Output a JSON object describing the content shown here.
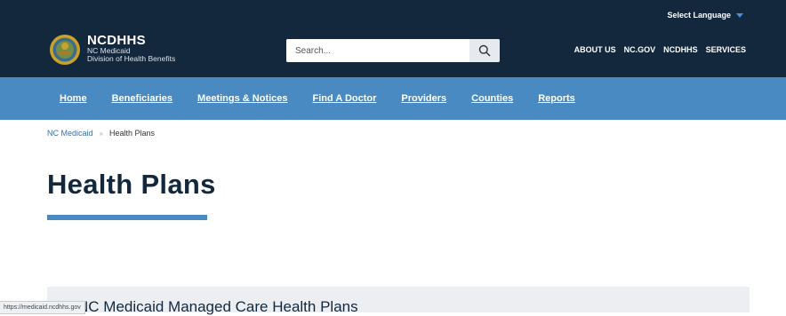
{
  "header": {
    "select_language": "Select Language",
    "brand_name": "NCDHHS",
    "brand_line1": "NC Medicaid",
    "brand_line2": "Division of Health Benefits",
    "search_placeholder": "Search...",
    "utility_links": [
      "ABOUT US",
      "NC.GOV",
      "NCDHHS",
      "SERVICES"
    ]
  },
  "nav": {
    "items": [
      "Home",
      "Beneficiaries",
      "Meetings & Notices",
      "Find A Doctor",
      "Providers",
      "Counties",
      "Reports"
    ]
  },
  "breadcrumb": {
    "home": "NC Medicaid",
    "current": "Health Plans"
  },
  "page": {
    "title": "Health Plans",
    "section_title": "NC Medicaid Managed Care Health Plans"
  },
  "status_bar": {
    "url": "https://medicaid.ncdhhs.gov"
  },
  "colors": {
    "header_bg": "#14283d",
    "nav_bg": "#4a8ac2",
    "accent": "#4a8ac2"
  },
  "icons": {
    "logo": "nc-state-seal-icon",
    "search": "search-icon",
    "language_caret": "caret-down-icon"
  }
}
